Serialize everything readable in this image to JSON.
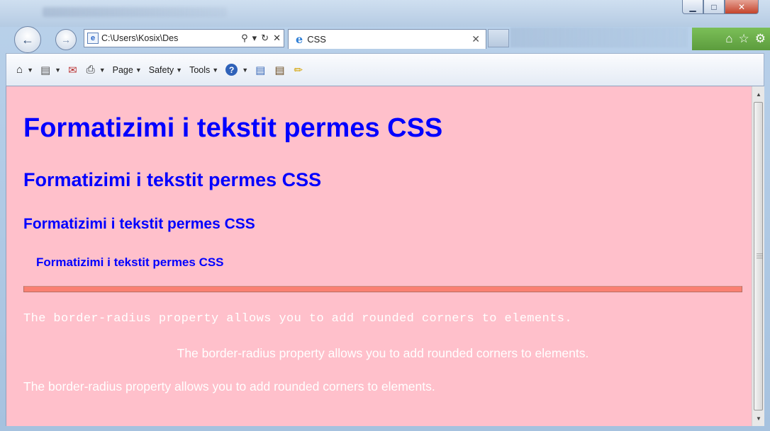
{
  "window": {
    "controls": {
      "minimize": "▁",
      "maximize": "□",
      "close": "✕"
    }
  },
  "navigation": {
    "back_icon": "back-arrow-icon",
    "forward_icon": "forward-arrow-icon",
    "address": "C:\\Users\\Kosix\\Des",
    "search_glyph": "⚲",
    "dropdown_glyph": "▾",
    "refresh_glyph": "↻",
    "stop_glyph": "✕"
  },
  "tab": {
    "title": "CSS",
    "close": "✕"
  },
  "toolbar_icons": {
    "home": "⌂",
    "favorites": "☆",
    "tools": "⚙"
  },
  "command_bar": {
    "items": [
      {
        "label": "Page"
      },
      {
        "label": "Safety"
      },
      {
        "label": "Tools"
      }
    ]
  },
  "page": {
    "headings": [
      "Formatizimi i tekstit permes CSS",
      "Formatizimi i tekstit permes CSS",
      "Formatizimi i tekstit permes CSS",
      "Formatizimi i tekstit permes CSS"
    ],
    "paragraphs": [
      "The border-radius property allows you to add rounded corners to elements.",
      "The border-radius property allows you to add rounded corners to elements.",
      "The border-radius property allows you to add rounded corners to elements."
    ],
    "colors": {
      "background": "#ffc0cb",
      "heading": "#0000ff",
      "text": "#ffffff",
      "rule": "#fa8072"
    }
  }
}
